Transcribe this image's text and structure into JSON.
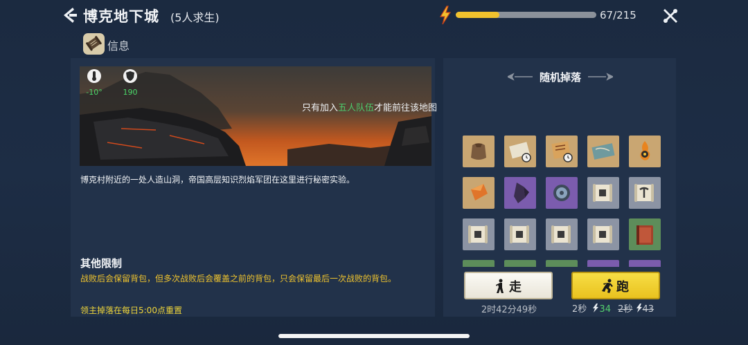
{
  "header": {
    "title": "博克地下城",
    "subtitle": "(5人求生)",
    "energy_text": "67/215",
    "energy_fraction": 0.311
  },
  "tabs": {
    "info_label": "信息"
  },
  "map": {
    "temperature": "-10°",
    "defense": "190",
    "notice_prefix": "只有加入",
    "notice_highlight": "五人队伍",
    "notice_suffix": "才能前往该地图",
    "description": "博克村附近的一处人造山洞，帝国高层知识烈焰军团在这里进行秘密实验。"
  },
  "restrictions": {
    "title": "其他限制",
    "text": "战败后会保留背包，但多次战败后会覆盖之前的背包，只会保留最后一次战败的背包。",
    "reset": "领主掉落在每日5:00点重置"
  },
  "drops": {
    "title": "随机掉落",
    "items": [
      {
        "icon": "leather-pouch-icon",
        "bg": "#c9a672"
      },
      {
        "icon": "blueprint-clock-icon",
        "bg": "#c9a672"
      },
      {
        "icon": "map-scroll-clock-icon",
        "bg": "#c9a672"
      },
      {
        "icon": "treasure-map-icon",
        "bg": "#c9a672"
      },
      {
        "icon": "flame-amulet-icon",
        "bg": "#c9a672"
      },
      {
        "icon": "amber-crystal-icon",
        "bg": "#c9a672"
      },
      {
        "icon": "dark-crystal-icon",
        "bg": "#7b5cae"
      },
      {
        "icon": "gear-disc-icon",
        "bg": "#7b5cae"
      },
      {
        "icon": "recipe-scroll-icon",
        "bg": "#8c94a4"
      },
      {
        "icon": "pickaxe-scroll-icon",
        "bg": "#8c94a4"
      },
      {
        "icon": "recipe-scroll-icon",
        "bg": "#8c94a4"
      },
      {
        "icon": "recipe-scroll-icon",
        "bg": "#8c94a4"
      },
      {
        "icon": "recipe-scroll-icon",
        "bg": "#8c94a4"
      },
      {
        "icon": "recipe-scroll-icon",
        "bg": "#8c94a4"
      },
      {
        "icon": "red-book-icon",
        "bg": "#5d8d5a"
      },
      {
        "icon": "item-icon",
        "bg": "#5d8d5a"
      },
      {
        "icon": "item-icon",
        "bg": "#5d8d5a"
      },
      {
        "icon": "item-icon",
        "bg": "#5d8d5a"
      },
      {
        "icon": "item-icon",
        "bg": "#7b5cae"
      },
      {
        "icon": "item-icon",
        "bg": "#7b5cae"
      }
    ]
  },
  "actions": {
    "walk_label": "走",
    "walk_time": "2时42分49秒",
    "run_label": "跑",
    "run_time": "2秒",
    "run_cost": "34",
    "run_old_time": "2秒",
    "run_old_cost": "43"
  }
}
